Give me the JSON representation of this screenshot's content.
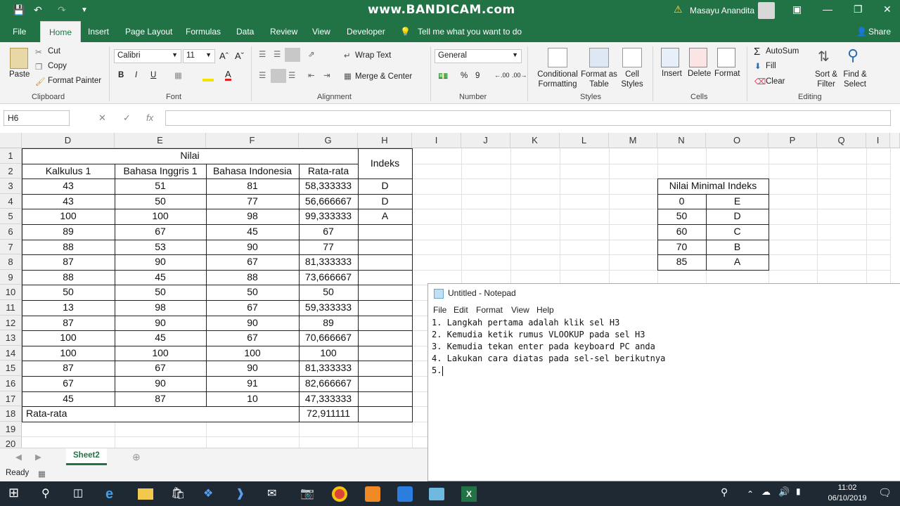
{
  "titlebar": {
    "watermark": "www.BANDICAM.com",
    "user": "Masayu Anandita"
  },
  "tabs": [
    "File",
    "Home",
    "Insert",
    "Page Layout",
    "Formulas",
    "Data",
    "Review",
    "View",
    "Developer"
  ],
  "tell_me": "Tell me what you want to do",
  "share": "Share",
  "ribbon": {
    "paste": "Paste",
    "cut": "Cut",
    "copy": "Copy",
    "format_painter": "Format Painter",
    "clipboard": "Clipboard",
    "font_name": "Calibri",
    "font_size": "11",
    "font": "Font",
    "bold": "B",
    "italic": "I",
    "underline": "U",
    "wrap_text": "Wrap Text",
    "merge_center": "Merge & Center",
    "alignment": "Alignment",
    "number_format": "General",
    "number": "Number",
    "percent": "%",
    "comma": "9",
    "conditional_formatting": "Conditional Formatting",
    "format_as_table": "Format as Table",
    "cell_styles": "Cell Styles",
    "styles": "Styles",
    "insert": "Insert",
    "delete": "Delete",
    "format": "Format",
    "cells": "Cells",
    "autosum": "AutoSum",
    "fill": "Fill",
    "clear": "Clear",
    "sort_filter": "Sort & Filter",
    "find_select": "Find & Select",
    "editing": "Editing"
  },
  "formula_bar": {
    "name_box": "H6",
    "formula": ""
  },
  "columns": [
    "D",
    "E",
    "F",
    "G",
    "H",
    "I",
    "J",
    "K",
    "L",
    "M",
    "N",
    "O",
    "P",
    "Q",
    "I"
  ],
  "rows": [
    "1",
    "2",
    "3",
    "4",
    "5",
    "6",
    "7",
    "8",
    "9",
    "10",
    "11",
    "12",
    "13",
    "14",
    "15",
    "16",
    "17",
    "18",
    "19",
    "20"
  ],
  "table": {
    "nilai": "Nilai",
    "indeks": "Indeks",
    "headers": [
      "Kalkulus 1",
      "Bahasa Inggris 1",
      "Bahasa Indonesia",
      "Rata-rata"
    ],
    "data": [
      [
        "43",
        "51",
        "81",
        "58,333333",
        "D"
      ],
      [
        "43",
        "50",
        "77",
        "56,666667",
        "D"
      ],
      [
        "100",
        "100",
        "98",
        "99,333333",
        "A"
      ],
      [
        "89",
        "67",
        "45",
        "67",
        ""
      ],
      [
        "88",
        "53",
        "90",
        "77",
        ""
      ],
      [
        "87",
        "90",
        "67",
        "81,333333",
        ""
      ],
      [
        "88",
        "45",
        "88",
        "73,666667",
        ""
      ],
      [
        "50",
        "50",
        "50",
        "50",
        ""
      ],
      [
        "13",
        "98",
        "67",
        "59,333333",
        ""
      ],
      [
        "87",
        "90",
        "90",
        "89",
        ""
      ],
      [
        "100",
        "45",
        "67",
        "70,666667",
        ""
      ],
      [
        "100",
        "100",
        "100",
        "100",
        ""
      ],
      [
        "87",
        "67",
        "90",
        "81,333333",
        ""
      ],
      [
        "67",
        "90",
        "91",
        "82,666667",
        ""
      ],
      [
        "45",
        "87",
        "10",
        "47,333333",
        ""
      ]
    ],
    "footer_label": "Rata-rata",
    "footer_value": "72,911111"
  },
  "lookup": {
    "header": "Nilai Minimal Indeks",
    "rows": [
      [
        "0",
        "E"
      ],
      [
        "50",
        "D"
      ],
      [
        "60",
        "C"
      ],
      [
        "70",
        "B"
      ],
      [
        "85",
        "A"
      ]
    ]
  },
  "sheet_tab": "Sheet2",
  "status": "Ready",
  "notepad": {
    "title": "Untitled - Notepad",
    "menu": [
      "File",
      "Edit",
      "Format",
      "View",
      "Help"
    ],
    "lines": [
      "1. Langkah pertama adalah klik sel H3",
      "2. Kemudia ketik rumus VLOOKUP pada sel H3",
      "3. Kemudia tekan enter pada keyboard PC anda",
      "4. Lakukan cara diatas pada sel-sel berikutnya",
      "5."
    ]
  },
  "taskbar": {
    "time": "11:02",
    "date": "06/10/2019"
  },
  "colors": {
    "excel_green": "#217346",
    "taskbar": "#1f2933"
  }
}
